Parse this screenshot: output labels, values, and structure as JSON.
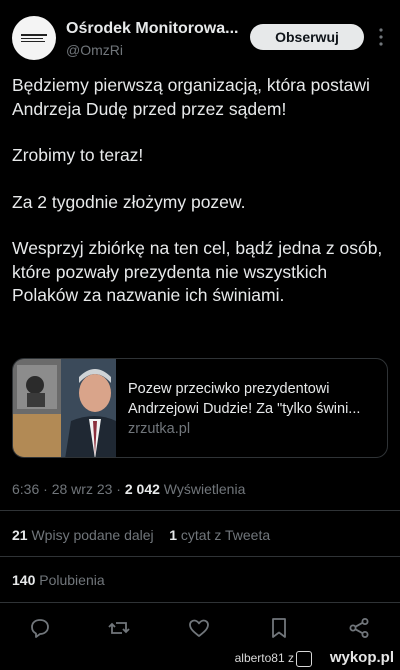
{
  "account": {
    "display_name": "Ośrodek Monitorowa...",
    "handle": "@OmzRi",
    "follow_label": "Obserwuj"
  },
  "tweet": {
    "paragraphs": [
      "Będziemy pierwszą organizacją, która postawi Andrzeja Dudę przed przez sądem!",
      "Zrobimy to teraz!",
      "Za 2 tygodnie złożymy pozew.",
      "Wesprzyj zbiórkę na ten cel, bądź jedna z osób, które pozwały prezydenta nie wszystkich Polaków za nazwanie ich świniami."
    ]
  },
  "card": {
    "title_line1": "Pozew przeciwko prezydentowi",
    "title_line2": "Andrzejowi Dudzie! Za \"tylko świni...",
    "domain": "zrzutka.pl"
  },
  "meta": {
    "time": "6:36",
    "separator": "·",
    "date": "28 wrz 23",
    "views_count": "2 042",
    "views_label": "Wyświetlenia"
  },
  "stats": {
    "retweets_count": "21",
    "retweets_label": "Wpisy podane dalej",
    "quotes_count": "1",
    "quotes_label": "cytat z Tweeta",
    "likes_count": "140",
    "likes_label": "Polubienia"
  },
  "actions": [
    "reply-icon",
    "retweet-icon",
    "like-icon",
    "bookmark-icon",
    "share-icon"
  ],
  "footer": {
    "username": "alberto81",
    "joiner": "z",
    "logo_text": "wykop.pl"
  },
  "colors": {
    "background": "#000000",
    "text": "#e7e9ea",
    "muted": "#71767b",
    "border": "#2f3336"
  }
}
